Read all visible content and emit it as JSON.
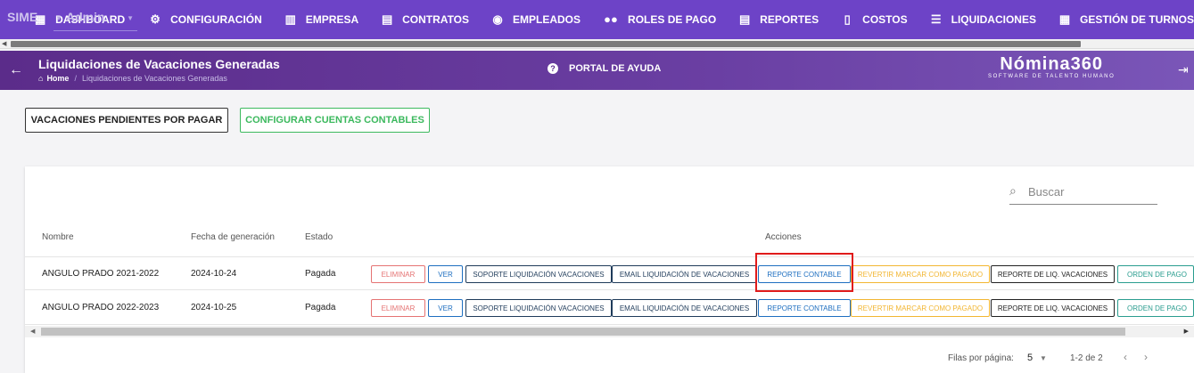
{
  "nav": {
    "brand": "SIME",
    "user": "Admin",
    "items": [
      {
        "label": "DASHBOARD",
        "icon": "dashboard-icon"
      },
      {
        "label": "CONFIGURACIÓN",
        "icon": "gear-icon"
      },
      {
        "label": "EMPRESA",
        "icon": "building-icon"
      },
      {
        "label": "CONTRATOS",
        "icon": "clipboard-icon"
      },
      {
        "label": "EMPLEADOS",
        "icon": "globe-user-icon"
      },
      {
        "label": "ROLES DE PAGO",
        "icon": "users-icon"
      },
      {
        "label": "REPORTES",
        "icon": "report-icon"
      },
      {
        "label": "COSTOS",
        "icon": "invoice-icon"
      },
      {
        "label": "LIQUIDACIONES",
        "icon": "list-icon"
      },
      {
        "label": "GESTIÓN DE TURNOS",
        "icon": "calendar-icon"
      }
    ]
  },
  "header": {
    "title": "Liquidaciones de Vacaciones Generadas",
    "breadcrumb_home": "Home",
    "breadcrumb_sep": "/",
    "breadcrumb_current": "Liquidaciones de Vacaciones Generadas",
    "help": "PORTAL DE AYUDA",
    "logo": "Nómina360",
    "logo_tagline": "SOFTWARE DE TALENTO HUMANO"
  },
  "buttons": {
    "pending": "VACACIONES PENDIENTES POR PAGAR",
    "configure": "CONFIGURAR CUENTAS CONTABLES"
  },
  "search": {
    "placeholder": "Buscar"
  },
  "table": {
    "headers": {
      "name": "Nombre",
      "date": "Fecha de generación",
      "state": "Estado",
      "actions": "Acciones"
    },
    "rows": [
      {
        "name": "ANGULO PRADO 2021-2022",
        "date": "2024-10-24",
        "state": "Pagada"
      },
      {
        "name": "ANGULO PRADO 2022-2023",
        "date": "2024-10-25",
        "state": "Pagada"
      }
    ],
    "actions": {
      "delete": "ELIMINAR",
      "view": "VER",
      "support": "SOPORTE LIQUIDACIÓN VACACIONES",
      "email": "EMAIL LIQUIDACIÓN DE VACACIONES",
      "accounting": "REPORTE CONTABLE",
      "revert": "REVERTIR MARCAR COMO PAGADO",
      "liq_report": "REPORTE DE LIQ. VACACIONES",
      "order": "ORDEN DE PAGO"
    }
  },
  "footer": {
    "rows_per_page_label": "Filas por página:",
    "rows_per_page": "5",
    "range": "1-2 de 2"
  },
  "colors": {
    "nav": "#6d43c7",
    "header": "#5b2c8a",
    "highlight": "#e01b1b",
    "success": "#3cb95e"
  }
}
